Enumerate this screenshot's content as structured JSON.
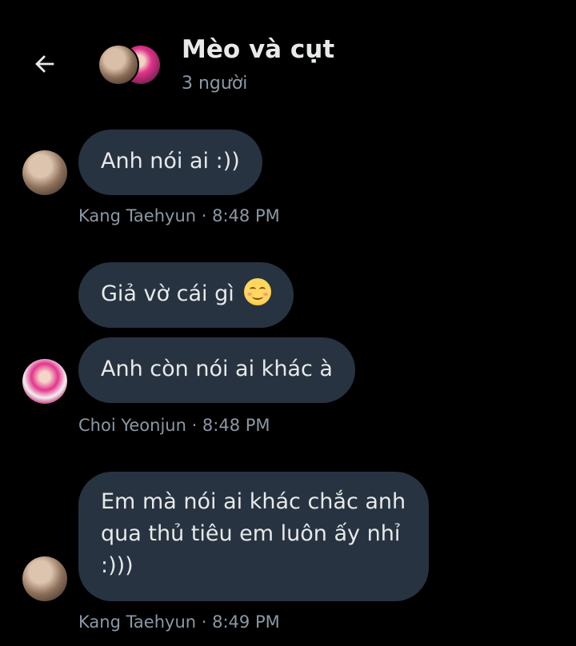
{
  "header": {
    "title": "Mèo và cụt",
    "subtitle": "3 người"
  },
  "messages": [
    {
      "text": "Anh nói ai :))",
      "meta": "Kang Taehyun · 8:48 PM"
    },
    {
      "text": "Giả vờ cái gì",
      "emoji": "smiling-face-emoji"
    },
    {
      "text": "Anh còn nói ai khác à",
      "meta": "Choi Yeonjun · 8:48 PM"
    },
    {
      "text": "Em mà nói ai khác chắc anh qua thủ tiêu em luôn ấy nhỉ :)))",
      "meta": "Kang Taehyun · 8:49 PM"
    }
  ],
  "colors": {
    "background": "#000000",
    "bubble": "#273340",
    "text": "#e7e9ea",
    "muted": "#8b98a5"
  }
}
